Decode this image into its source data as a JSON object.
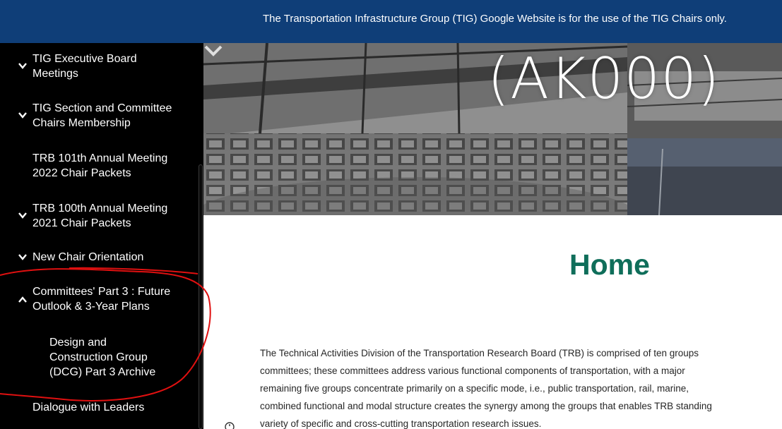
{
  "banner": {
    "text": "The Transportation Infrastructure Group (TIG) Google Website is for the use of the TIG Chairs only."
  },
  "sidebar": {
    "items": [
      {
        "lines": [
          "TIG Executive Board",
          "Meetings"
        ],
        "icon": "chevron-down-icon"
      },
      {
        "lines": [
          "TIG Section and Committee",
          "Chairs Membership"
        ],
        "icon": "chevron-down-icon"
      },
      {
        "lines": [
          "TRB 101th Annual Meeting",
          "2022 Chair Packets"
        ],
        "icon": ""
      },
      {
        "lines": [
          "TRB 100th Annual Meeting",
          "2021 Chair Packets"
        ],
        "icon": "chevron-down-icon"
      },
      {
        "lines": [
          "New Chair Orientation"
        ],
        "icon": "chevron-down-icon"
      },
      {
        "lines": [
          "Committees' Part 3 : Future",
          "Outlook & 3-Year Plans"
        ],
        "icon": "chevron-up-icon"
      },
      {
        "lines": [
          "Design and",
          "Construction Group",
          "(DCG) Part 3 Archive"
        ],
        "icon": ""
      },
      {
        "lines": [
          "Dialogue with Leaders"
        ],
        "icon": ""
      }
    ]
  },
  "hero": {
    "title": "(AK000)"
  },
  "main": {
    "page_title": "Home",
    "paragraph_lines": [
      "The Technical Activities Division of the Transportation Research Board (TRB) is comprised of ten groups",
      "committees; these committees address various functional components of transportation, with a major",
      "remaining five groups concentrate primarily on a specific mode, i.e., public transportation, rail, marine,",
      "combined functional and modal structure creates the synergy among the groups that enables TRB standing",
      "variety of specific and cross-cutting transportation research issues."
    ]
  },
  "colors": {
    "banner_bg": "#0f3e78",
    "sidebar_bg": "#000000",
    "title_green": "#0f6e5a",
    "annotation_red": "#e01010"
  }
}
